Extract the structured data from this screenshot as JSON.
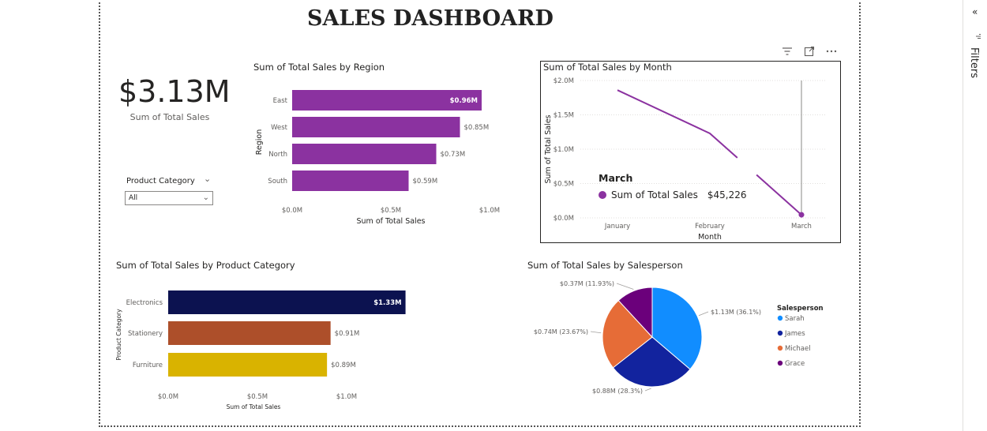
{
  "dashboard": {
    "title": "SALES DASHBOARD"
  },
  "kpi": {
    "value": "$3.13M",
    "label": "Sum of Total Sales"
  },
  "slicer": {
    "title": "Product Category",
    "selected": "All"
  },
  "toolbar": {
    "filter_icon": "filter-icon",
    "focus_icon": "focus-mode-icon",
    "more_icon": "more-options-icon"
  },
  "filters_pane": {
    "label": "Filters",
    "collapse_icon": "double-chevron-icon"
  },
  "tooltip": {
    "header": "March",
    "series": "Sum of Total Sales",
    "value": "$45,226"
  },
  "colors": {
    "purple": "#8b32a0",
    "electronics": "#0c1250",
    "stationery": "#ad4f2a",
    "furniture": "#d9b300",
    "sarah": "#118dff",
    "james": "#12239e",
    "michael": "#e66c37",
    "grace": "#6b007b"
  },
  "chart_data": [
    {
      "id": "region",
      "type": "bar",
      "orientation": "horizontal",
      "title": "Sum of Total Sales by Region",
      "xlabel": "Sum of Total Sales",
      "ylabel": "Region",
      "categories": [
        "East",
        "West",
        "North",
        "South"
      ],
      "values": [
        0.96,
        0.85,
        0.73,
        0.59
      ],
      "data_labels": [
        "$0.96M",
        "$0.85M",
        "$0.73M",
        "$0.59M"
      ],
      "xlim": [
        0,
        1.0
      ],
      "ticks": [
        "$0.0M",
        "$0.5M",
        "$1.0M"
      ]
    },
    {
      "id": "month",
      "type": "line",
      "title": "Sum of Total Sales by Month",
      "xlabel": "Month",
      "ylabel": "Sum of Total Sales",
      "categories": [
        "January",
        "February",
        "March"
      ],
      "values": [
        1.86,
        1.23,
        0.045226
      ],
      "ylim": [
        0,
        2.0
      ],
      "ticks": [
        "$0.0M",
        "$0.5M",
        "$1.0M",
        "$1.5M",
        "$2.0M"
      ],
      "grid": true
    },
    {
      "id": "category",
      "type": "bar",
      "orientation": "horizontal",
      "title": "Sum of Total Sales by Product Category",
      "xlabel": "Sum of Total Sales",
      "ylabel": "Product Category",
      "categories": [
        "Electronics",
        "Stationery",
        "Furniture"
      ],
      "values": [
        1.33,
        0.91,
        0.89
      ],
      "data_labels": [
        "$1.33M",
        "$0.91M",
        "$0.89M"
      ],
      "xlim": [
        0,
        1.0
      ],
      "ticks": [
        "$0.0M",
        "$0.5M",
        "$1.0M"
      ]
    },
    {
      "id": "salesperson",
      "type": "pie",
      "title": "Sum of Total Sales by Salesperson",
      "legend_title": "Salesperson",
      "legend_position": "right",
      "labels": [
        "Sarah",
        "James",
        "Michael",
        "Grace"
      ],
      "values": [
        1.13,
        0.88,
        0.74,
        0.37
      ],
      "percent": [
        36.1,
        28.3,
        23.67,
        11.93
      ],
      "data_labels": [
        "$1.13M (36.1%)",
        "$0.88M (28.3%)",
        "$0.74M (23.67%)",
        "$0.37M (11.93%)"
      ]
    }
  ]
}
